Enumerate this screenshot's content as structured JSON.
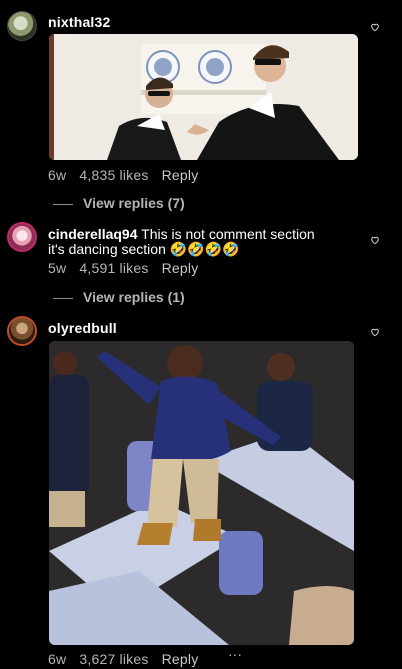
{
  "comments": [
    {
      "username": "nixthal32",
      "text": "",
      "time": "6w",
      "likes": "4,835 likes",
      "reply": "Reply",
      "view_replies": "View replies (7)",
      "avatar_icon": "avatar-icon",
      "heart_icon": "heart-outline-icon"
    },
    {
      "username": "cinderellaq94",
      "text_line1": "This is not comment section",
      "text_line2": "it's dancing section",
      "emoji": "🤣🤣🤣🤣",
      "time": "5w",
      "likes": "4,591 likes",
      "reply": "Reply",
      "view_replies": "View replies (1)",
      "heart_icon": "heart-outline-icon"
    },
    {
      "username": "olyredbull",
      "time": "6w",
      "likes": "3,627 likes",
      "reply": "Reply",
      "more": "···",
      "heart_icon": "heart-outline-icon"
    }
  ],
  "colors": {
    "background": "#000000",
    "text": "#ffffff",
    "meta": "#b5b5b5"
  }
}
